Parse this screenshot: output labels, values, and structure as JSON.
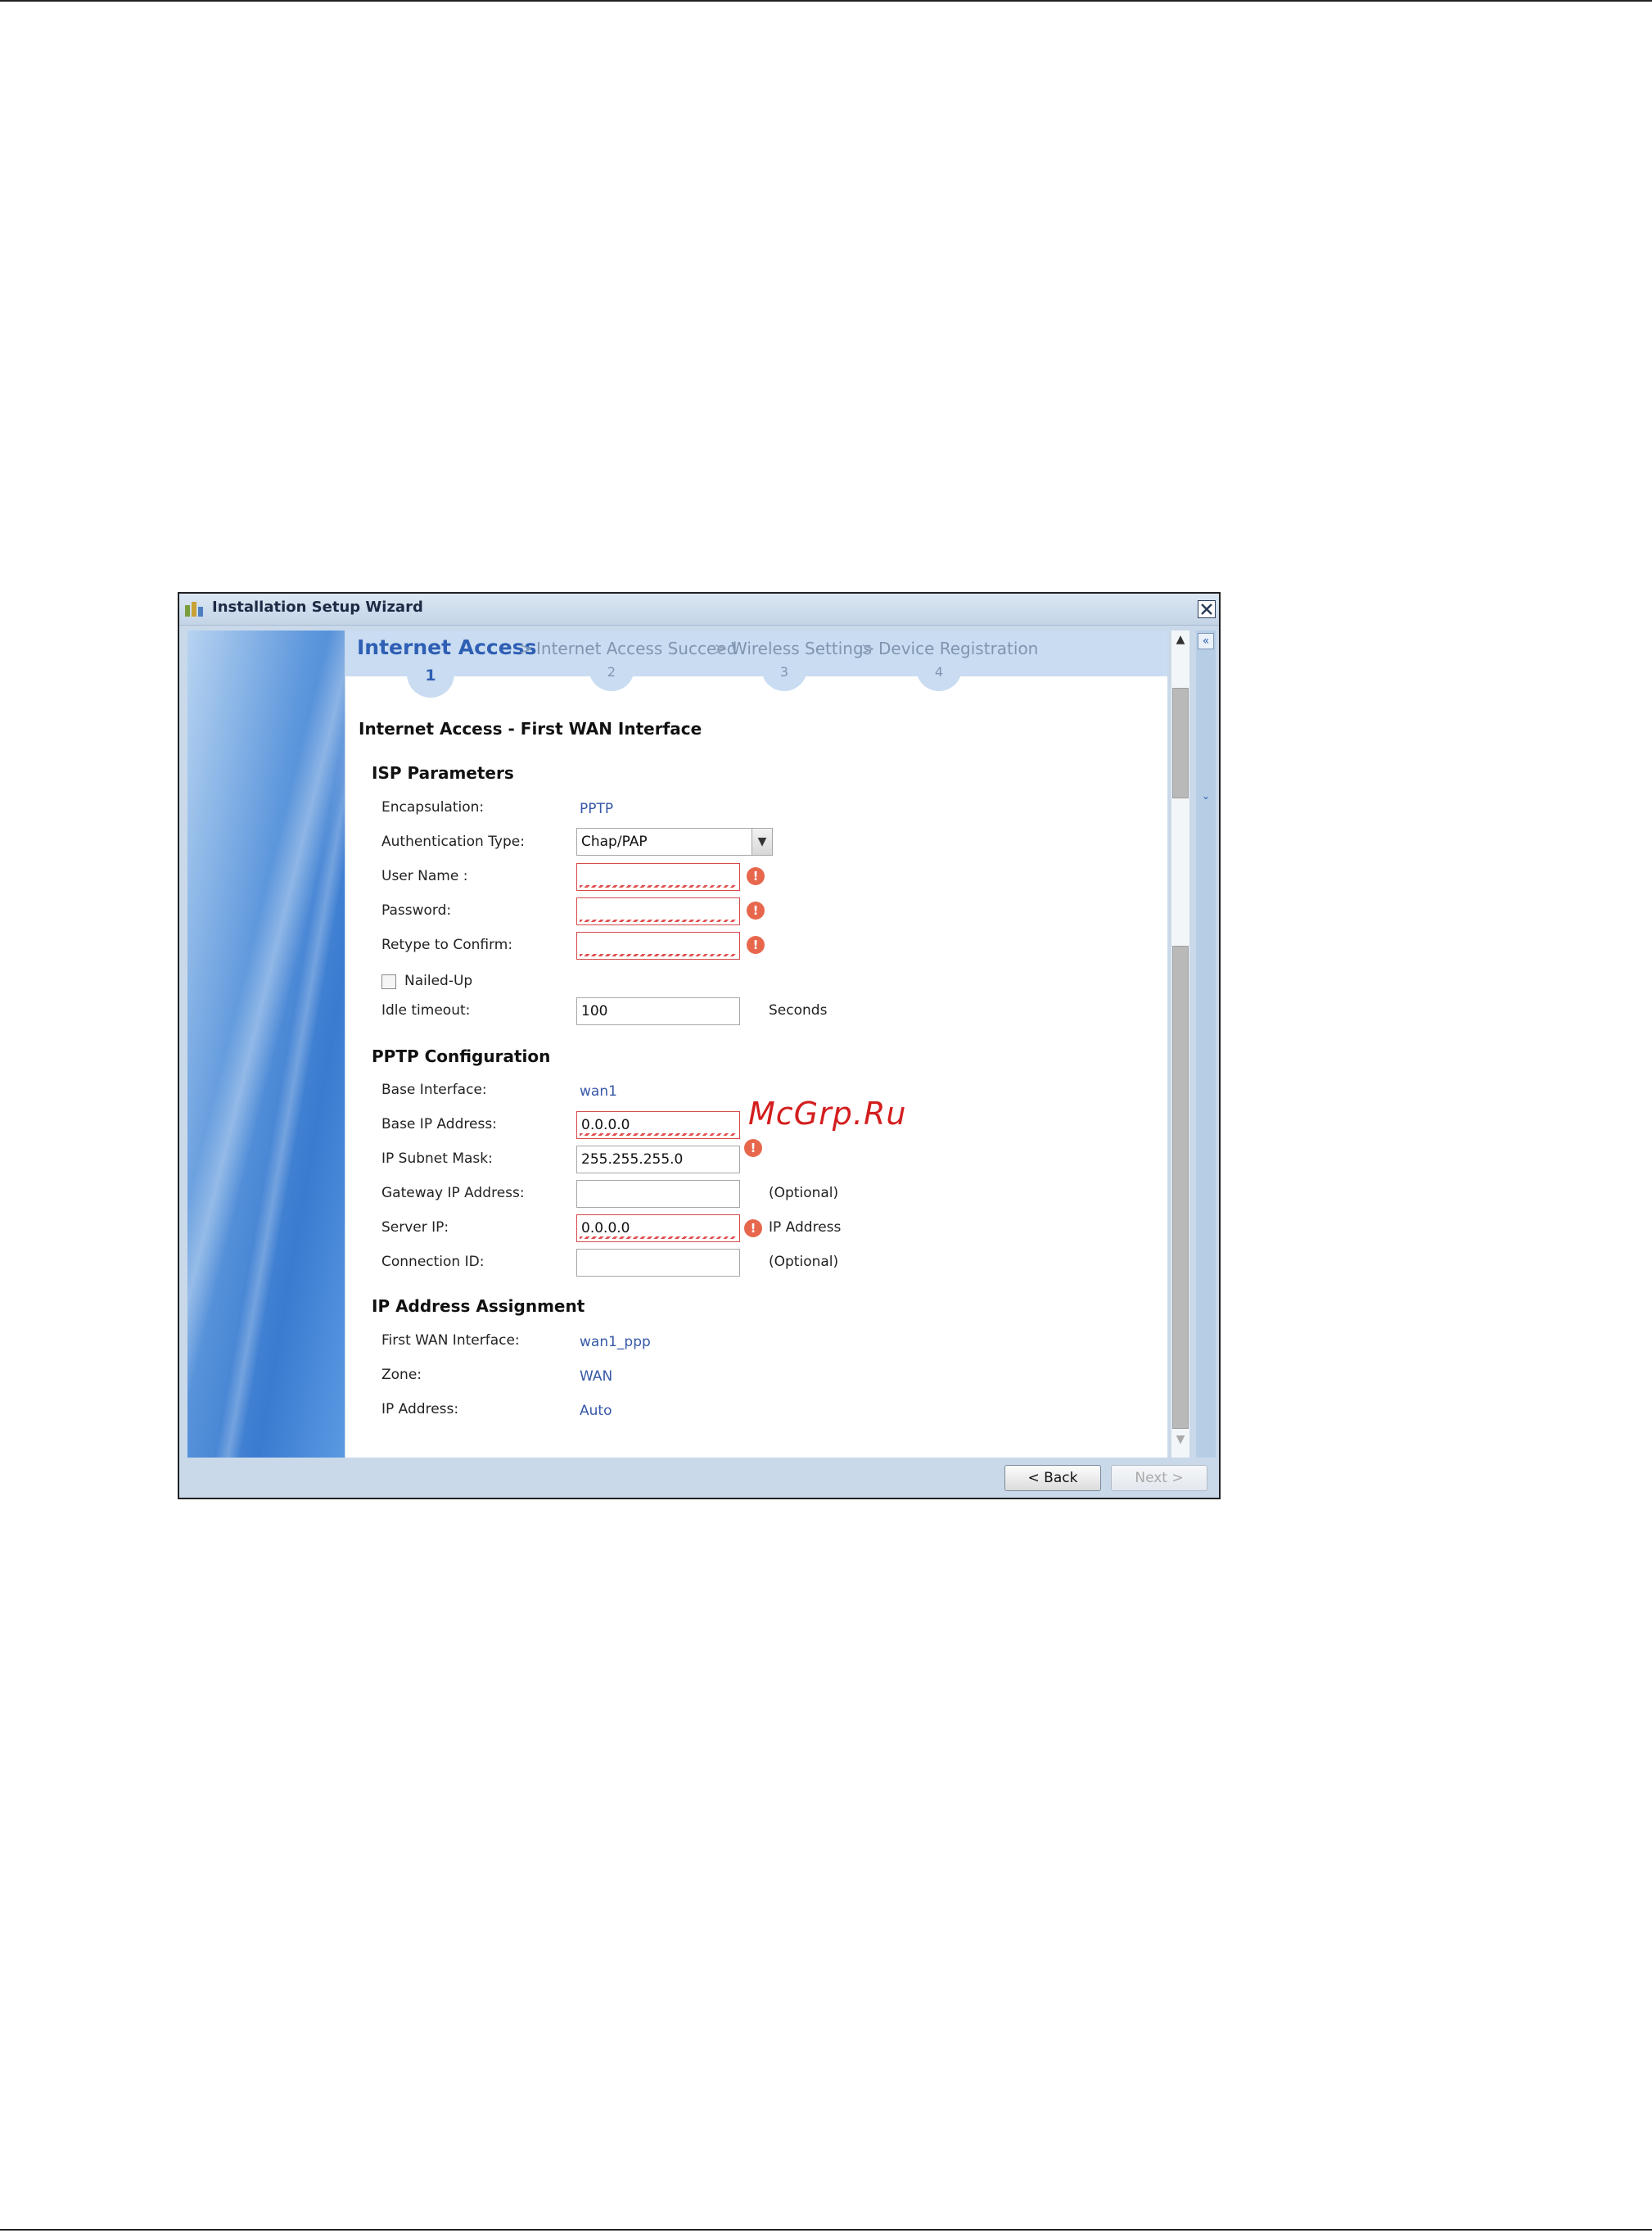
{
  "window": {
    "title": "Installation Setup Wizard"
  },
  "steps": [
    {
      "label": "Internet Access",
      "number": "1"
    },
    {
      "label": "Internet Access Succeed",
      "number": "2"
    },
    {
      "label": "Wireless Settings",
      "number": "3"
    },
    {
      "label": "Device Registration",
      "number": "4"
    }
  ],
  "page_title": "Internet Access - First WAN Interface",
  "isp": {
    "heading": "ISP Parameters",
    "encapsulation_label": "Encapsulation:",
    "encapsulation_value": "PPTP",
    "auth_label": "Authentication Type:",
    "auth_value": "Chap/PAP",
    "username_label": "User Name :",
    "username_value": "",
    "password_label": "Password:",
    "password_value": "",
    "retype_label": "Retype to Confirm:",
    "retype_value": "",
    "nailed_label": "Nailed-Up",
    "idle_label": "Idle timeout:",
    "idle_value": "100",
    "idle_unit": "Seconds"
  },
  "pptp": {
    "heading": "PPTP Configuration",
    "base_iface_label": "Base Interface:",
    "base_iface_value": "wan1",
    "base_ip_label": "Base IP Address:",
    "base_ip_value": "0.0.0.0",
    "subnet_label": "IP Subnet Mask:",
    "subnet_value": "255.255.255.0",
    "gateway_label": "Gateway IP Address:",
    "gateway_value": "",
    "gateway_note": "(Optional)",
    "server_label": "Server IP:",
    "server_value": "0.0.0.0",
    "server_note": "IP Address",
    "connid_label": "Connection ID:",
    "connid_value": "",
    "connid_note": "(Optional)"
  },
  "assign": {
    "heading": "IP Address Assignment",
    "wan_label": "First WAN Interface:",
    "wan_value": "wan1_ppp",
    "zone_label": "Zone:",
    "zone_value": "WAN",
    "ip_label": "IP Address:",
    "ip_value": "Auto"
  },
  "buttons": {
    "back": "< Back",
    "next": "Next >"
  },
  "warning_glyph": "!",
  "watermark": "McGrp.Ru",
  "colors": {
    "accent": "#2f5fb4",
    "value_text": "#3658a8",
    "error": "#e7674d",
    "watermark": "#d41e1e"
  }
}
